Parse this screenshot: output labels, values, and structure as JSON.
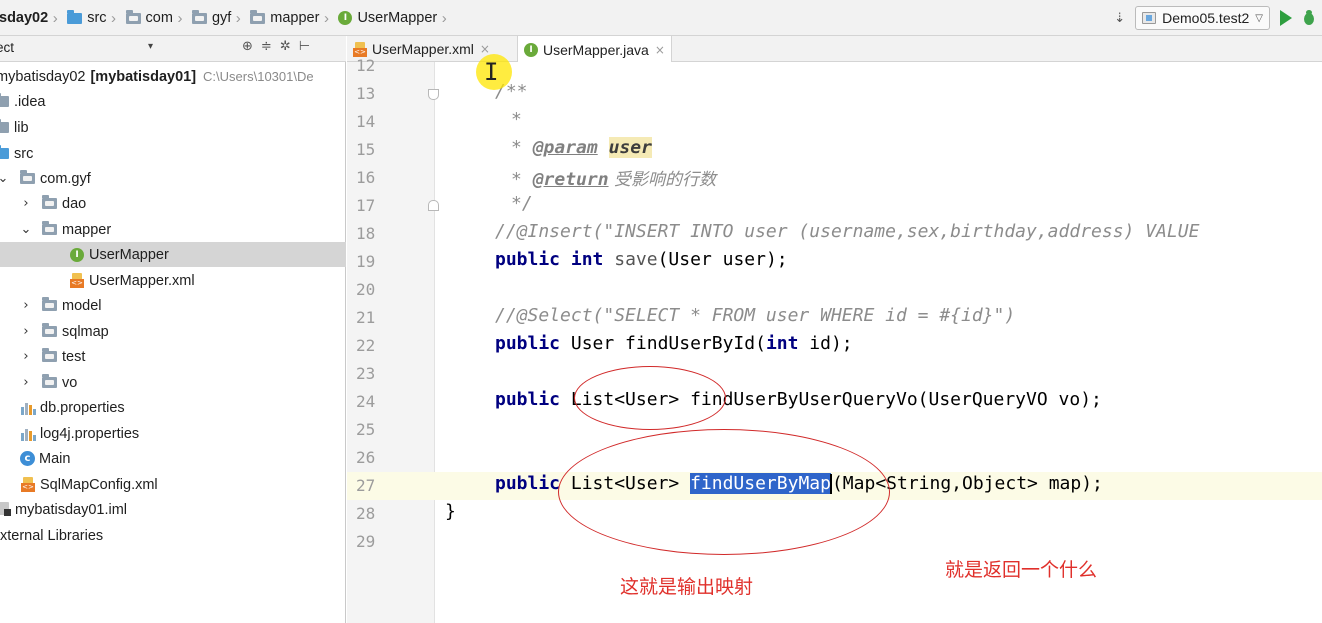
{
  "breadcrumb": {
    "items": [
      "sday02",
      "src",
      "com",
      "gyf",
      "mapper",
      "UserMapper"
    ]
  },
  "toolbar": {
    "run_config": "Demo05.test2"
  },
  "project_panel": {
    "title": "ect",
    "tree": [
      {
        "label": "mybatisday02",
        "bold_suffix": "[mybatisday01]",
        "path": "C:\\Users\\10301\\De",
        "icon": "module-icon"
      },
      {
        "label": ".idea",
        "icon": "folder-icon"
      },
      {
        "label": "lib",
        "icon": "folder-icon"
      },
      {
        "label": "src",
        "icon": "source-folder-icon"
      },
      {
        "label": "com.gyf",
        "icon": "package-icon",
        "expanded": true
      },
      {
        "label": "dao",
        "icon": "package-icon",
        "expanded": false
      },
      {
        "label": "mapper",
        "icon": "package-icon",
        "expanded": true
      },
      {
        "label": "UserMapper",
        "icon": "interface-icon",
        "selected": true
      },
      {
        "label": "UserMapper.xml",
        "icon": "xml-file-icon"
      },
      {
        "label": "model",
        "icon": "package-icon",
        "expanded": false
      },
      {
        "label": "sqlmap",
        "icon": "package-icon",
        "expanded": false
      },
      {
        "label": "test",
        "icon": "package-icon",
        "expanded": false
      },
      {
        "label": "vo",
        "icon": "package-icon",
        "expanded": false
      },
      {
        "label": "db.properties",
        "icon": "properties-file-icon"
      },
      {
        "label": "log4j.properties",
        "icon": "properties-file-icon"
      },
      {
        "label": "Main",
        "icon": "class-icon"
      },
      {
        "label": "SqlMapConfig.xml",
        "icon": "xml-file-icon"
      },
      {
        "label": "mybatisday01.iml",
        "icon": "iml-file-icon"
      },
      {
        "label": "xternal Libraries",
        "icon": "libraries-icon"
      }
    ]
  },
  "editor": {
    "tabs": [
      {
        "label": "UserMapper.xml",
        "active": false
      },
      {
        "label": "UserMapper.java",
        "active": true
      }
    ],
    "line_numbers": [
      "12",
      "13",
      "14",
      "15",
      "16",
      "17",
      "18",
      "19",
      "20",
      "21",
      "22",
      "23",
      "24",
      "25",
      "26",
      "27",
      "28",
      "29"
    ],
    "current_line": "27",
    "code": {
      "l13": "/**",
      "l14": "*",
      "l15_star": "* ",
      "l15_tag": "@param",
      "l15_name": "user",
      "l16_star": "* ",
      "l16_tag": "@return",
      "l16_text": " 受影响的行数",
      "l17": "*/",
      "l18": "//@Insert(\"INSERT INTO user (username,sex,birthday,address) VALUE",
      "l19_kw1": "public",
      "l19_kw2": "int",
      "l19_method": "save",
      "l19_rest": "(User user);",
      "l21": "//@Select(\"SELECT * FROM user WHERE id = #{id}\")",
      "l22_kw": "public",
      "l22_mid": " User findUserById(",
      "l22_kw2": "int",
      "l22_rest": " id);",
      "l24_kw": "public",
      "l24_rest": " List<User> findUserByUserQueryVo(UserQueryVO vo);",
      "l27_kw": "public",
      "l27_mid": " List<User> ",
      "l27_sel": "findUserByMap",
      "l27_rest": "(Map<String,Object> map);",
      "l28": "}"
    }
  },
  "annotations": {
    "note1": "这就是输出映射",
    "note2": "就是返回一个什么",
    "color": "#e0302b"
  }
}
